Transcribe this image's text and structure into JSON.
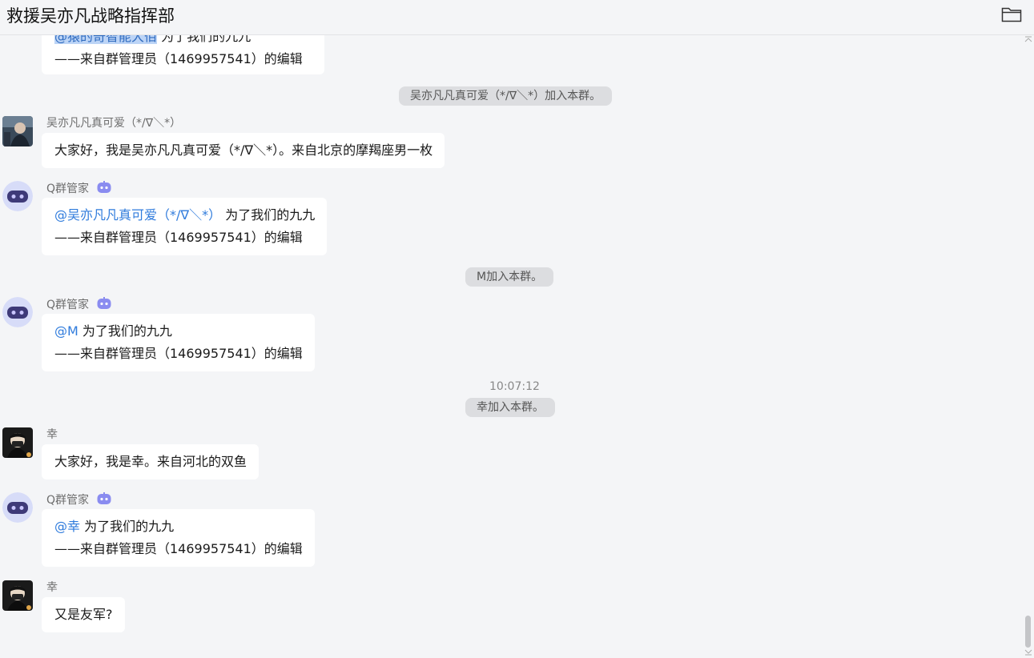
{
  "header": {
    "title": "救援吴亦凡战略指挥部",
    "folder_icon": "folder-icon"
  },
  "messages": {
    "partial": {
      "mention": "@猿的奇智能大佰",
      "rest": "为了我们的九九",
      "line2": "——来自群管理员（1469957541）的编辑"
    },
    "sys1": "吴亦凡凡真可爱（*/∇＼*）加入本群。",
    "m1": {
      "sender": "吴亦凡凡真可爱（*/∇＼*）",
      "text": "大家好，我是吴亦凡凡真可爱（*/∇＼*）。来自北京的摩羯座男一枚"
    },
    "m2": {
      "sender": "Q群管家",
      "mention": "@吴亦凡凡真可爱（*/∇＼*）",
      "rest": " 为了我们的九九",
      "line2": "——来自群管理员（1469957541）的编辑"
    },
    "sys2": "M加入本群。",
    "m3": {
      "sender": "Q群管家",
      "mention": "@M",
      "rest": " 为了我们的九九",
      "line2": "——来自群管理员（1469957541）的编辑"
    },
    "time1": "10:07:12",
    "sys3": "幸加入本群。",
    "m4": {
      "sender": "幸",
      "text": "大家好，我是幸。来自河北的双鱼"
    },
    "m5": {
      "sender": "Q群管家",
      "mention": "@幸",
      "rest": " 为了我们的九九",
      "line2": "——来自群管理员（1469957541）的编辑"
    },
    "m6": {
      "sender": "幸",
      "text": "又是友军?"
    }
  },
  "colors": {
    "mention": "#2f7bdc",
    "background": "#f4f5f7",
    "bubble": "#ffffff",
    "bot_badge": "#8a8cf0"
  }
}
